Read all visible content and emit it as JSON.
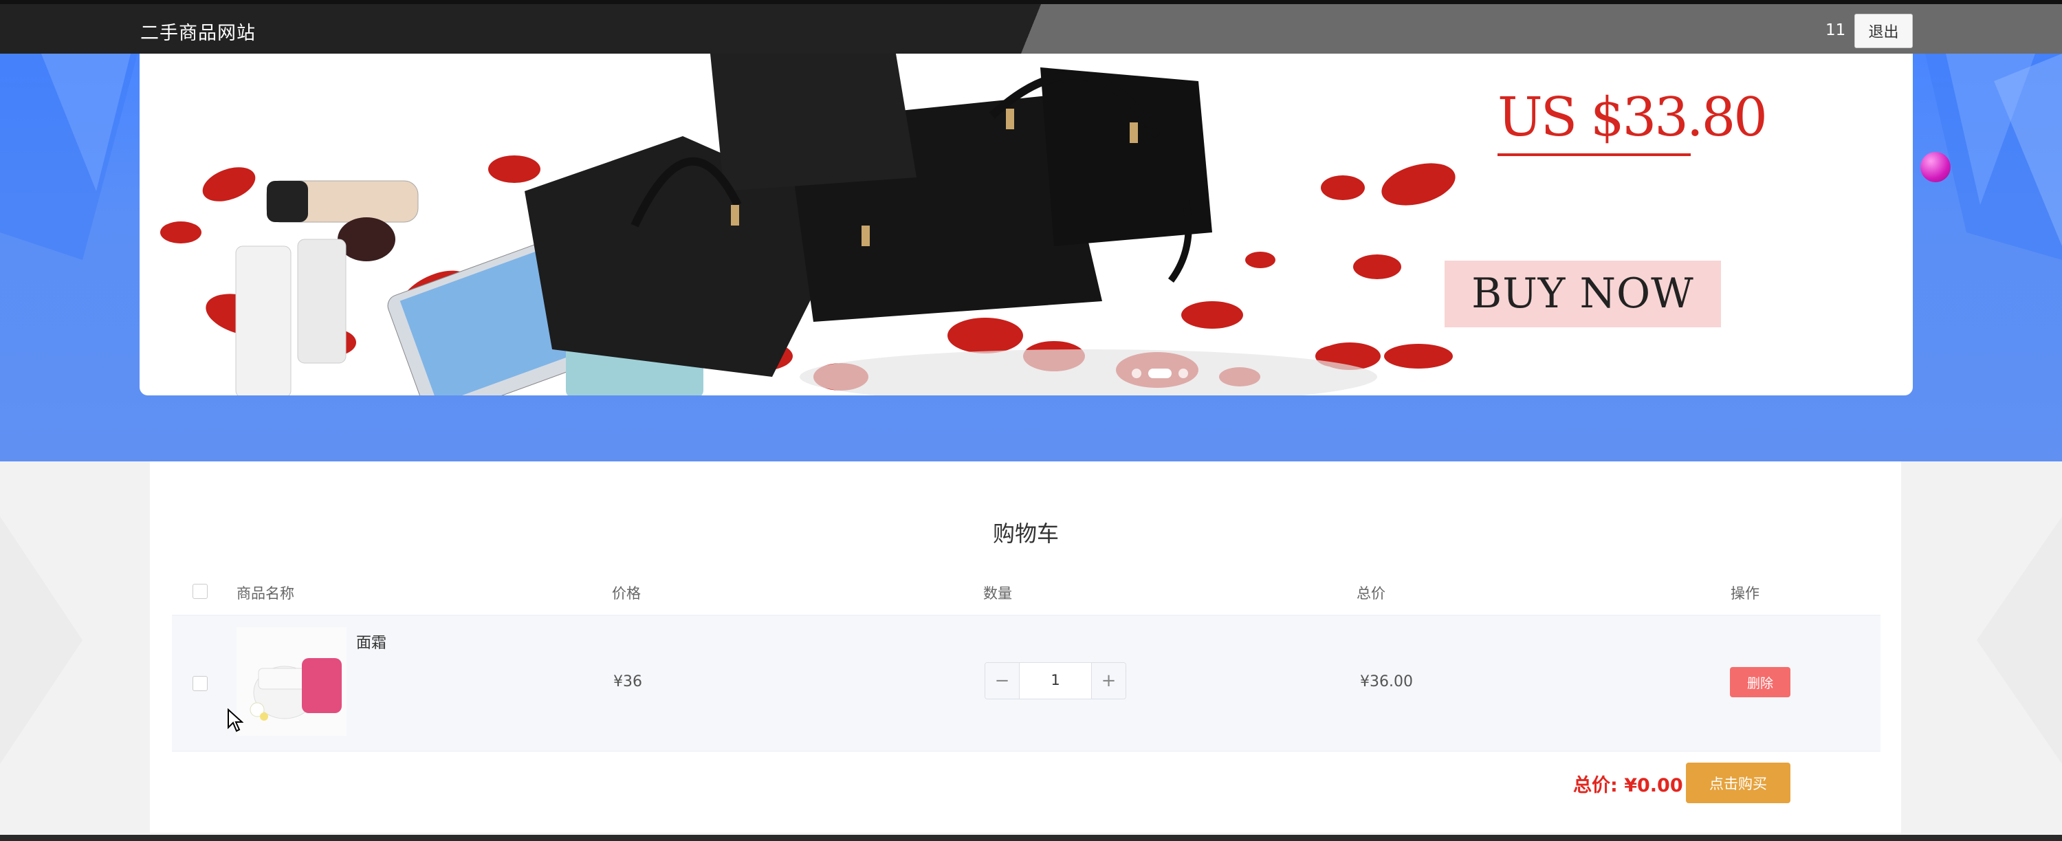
{
  "header": {
    "site_title": "二手商品网站",
    "username": "11",
    "logout_label": "退出"
  },
  "banner": {
    "price_text": "US $33.80",
    "cta_text": "BUY NOW",
    "prev_label": "‹",
    "next_label": "›",
    "slide_count": 3,
    "active_slide": 2
  },
  "cart": {
    "title": "购物车",
    "columns": {
      "name": "商品名称",
      "price": "价格",
      "quantity": "数量",
      "total": "总价",
      "action": "操作"
    },
    "items": [
      {
        "name": "面霜",
        "price": "¥36",
        "quantity": "1",
        "total": "¥36.00",
        "delete_label": "删除"
      }
    ],
    "qty_minus": "−",
    "qty_plus": "+",
    "grand_total": "总价: ¥0.00",
    "buy_label": "点击购买"
  },
  "colors": {
    "topbar": "#222222",
    "hero_blue": "#5a8ff7",
    "price_red": "#d6261f",
    "delete_red": "#f56c6c",
    "buy_orange": "#e6a23c"
  }
}
